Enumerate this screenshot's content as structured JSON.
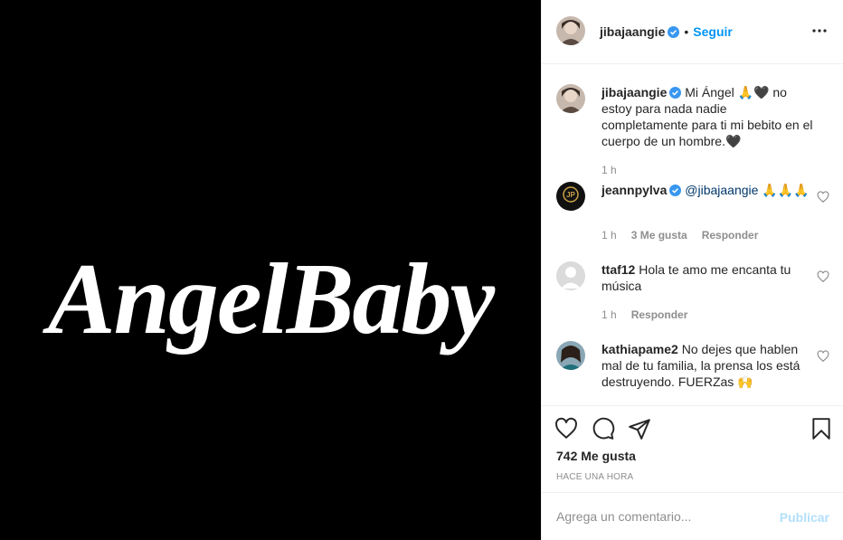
{
  "media": {
    "image_text": "AngelBaby",
    "background": "#000000",
    "text_color": "#ffffff"
  },
  "header": {
    "username": "jibajaangie",
    "separator": "•",
    "follow_label": "Seguir",
    "avatar_icon": "avatar-photo"
  },
  "caption": {
    "username": "jibajaangie",
    "text": "Mi Ángel 🙏🖤 no estoy para nada nadie completamente para ti mi bebito en el cuerpo de un hombre.🖤",
    "time": "1 h"
  },
  "comments": [
    {
      "username": "jeannpylva",
      "mention": "@jibajaangie",
      "text": " 🙏🙏🙏",
      "time": "1 h",
      "likes": "3 Me gusta",
      "reply": "Responder"
    },
    {
      "username": "ttaf12",
      "text": "Hola te amo me encanta tu música",
      "time": "1 h",
      "reply": "Responder"
    },
    {
      "username": "kathiapame2",
      "text": "No dejes que hablen mal de tu familia, la prensa los está destruyendo. FUERZas 🙌"
    }
  ],
  "actions": {
    "likes": "742 Me gusta",
    "timestamp": "HACE UNA HORA"
  },
  "add_comment": {
    "placeholder": "Agrega un comentario...",
    "post_label": "Publicar"
  },
  "colors": {
    "accent": "#0095f6",
    "muted": "#8e8e8e",
    "verified": "#3897f0"
  }
}
